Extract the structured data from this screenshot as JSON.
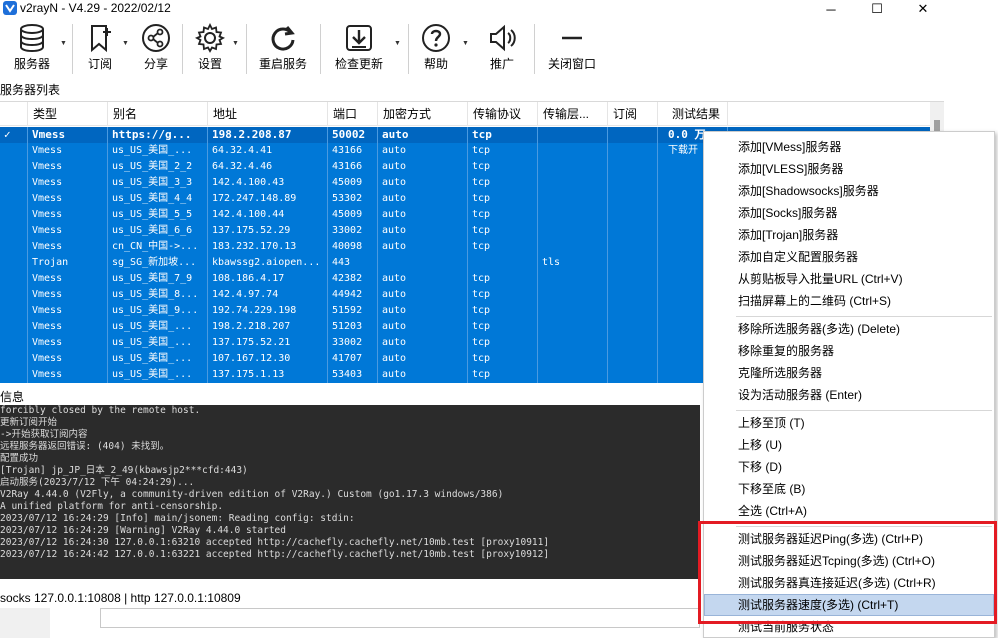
{
  "window": {
    "title": "v2rayN - V4.29 - 2022/02/12",
    "min_glyph": "─",
    "max_glyph": "☐",
    "close_glyph": "✕"
  },
  "toolbar": {
    "servers": "服务器",
    "subscribe": "订阅",
    "share": "分享",
    "settings": "设置",
    "restart": "重启服务",
    "check_update": "检查更新",
    "help": "帮助",
    "promote": "推广",
    "close_window": "关闭窗口",
    "caret": "▼"
  },
  "server_list_label": "服务器列表",
  "grid": {
    "headers": [
      "类型",
      "别名",
      "地址",
      "端口",
      "加密方式",
      "传输协议",
      "传输层...",
      "订阅",
      "测试结果"
    ],
    "rows": [
      [
        "Vmess",
        "https://g...",
        "198.2.208.87",
        "50002",
        "auto",
        "tcp",
        "",
        "",
        "0.0 万"
      ],
      [
        "Vmess",
        "us_US_美国_...",
        "64.32.4.41",
        "43166",
        "auto",
        "tcp",
        "",
        "",
        "下载开"
      ],
      [
        "Vmess",
        "us_US_美国_2_2",
        "64.32.4.46",
        "43166",
        "auto",
        "tcp",
        "",
        "",
        ""
      ],
      [
        "Vmess",
        "us_US_美国_3_3",
        "142.4.100.43",
        "45009",
        "auto",
        "tcp",
        "",
        "",
        ""
      ],
      [
        "Vmess",
        "us_US_美国_4_4",
        "172.247.148.89",
        "53302",
        "auto",
        "tcp",
        "",
        "",
        ""
      ],
      [
        "Vmess",
        "us_US_美国_5_5",
        "142.4.100.44",
        "45009",
        "auto",
        "tcp",
        "",
        "",
        ""
      ],
      [
        "Vmess",
        "us_US_美国_6_6",
        "137.175.52.29",
        "33002",
        "auto",
        "tcp",
        "",
        "",
        ""
      ],
      [
        "Vmess",
        "cn_CN_中国->...",
        "183.232.170.13",
        "40098",
        "auto",
        "tcp",
        "",
        "",
        ""
      ],
      [
        "Trojan",
        "sg_SG_新加坡...",
        "kbawssg2.aiopen...",
        "443",
        "",
        "",
        "tls",
        "",
        ""
      ],
      [
        "Vmess",
        "us_US_美国_7_9",
        "108.186.4.17",
        "42382",
        "auto",
        "tcp",
        "",
        "",
        ""
      ],
      [
        "Vmess",
        "us_US_美国_8...",
        "142.4.97.74",
        "44942",
        "auto",
        "tcp",
        "",
        "",
        ""
      ],
      [
        "Vmess",
        "us_US_美国_9...",
        "192.74.229.198",
        "51592",
        "auto",
        "tcp",
        "",
        "",
        ""
      ],
      [
        "Vmess",
        "us_US_美国_...",
        "198.2.218.207",
        "51203",
        "auto",
        "tcp",
        "",
        "",
        ""
      ],
      [
        "Vmess",
        "us_US_美国_...",
        "137.175.52.21",
        "33002",
        "auto",
        "tcp",
        "",
        "",
        ""
      ],
      [
        "Vmess",
        "us_US_美国_...",
        "107.167.12.30",
        "41707",
        "auto",
        "tcp",
        "",
        "",
        ""
      ],
      [
        "Vmess",
        "us_US_美国_...",
        "137.175.1.13",
        "53403",
        "auto",
        "tcp",
        "",
        "",
        ""
      ]
    ],
    "check_glyph": "✓"
  },
  "info_label": "信息",
  "log": [
    "forcibly closed by the remote host.",
    "更新订阅开始",
    "->开始获取订阅内容",
    "远程服务器返回错误: (404) 未找到。",
    "配置成功",
    "[Trojan] jp_JP_日本_2_49(kbawsjp2***cfd:443)",
    "启动服务(2023/7/12 下午 04:24:29)...",
    "V2Ray 4.44.0 (V2Fly, a community-driven edition of V2Ray.) Custom (go1.17.3 windows/386)",
    "A unified platform for anti-censorship.",
    "2023/07/12 16:24:29 [Info] main/jsonem: Reading config: stdin:",
    "2023/07/12 16:24:29 [Warning] V2Ray 4.44.0 started",
    "2023/07/12 16:24:30 127.0.0.1:63210 accepted http://cachefly.cachefly.net/10mb.test [proxy10911]",
    "2023/07/12 16:24:42 127.0.0.1:63221 accepted http://cachefly.cachefly.net/10mb.test [proxy10912]"
  ],
  "statusbar": "socks 127.0.0.1:10808 | http 127.0.0.1:10809",
  "context_menu": {
    "add_vmess": "添加[VMess]服务器",
    "add_vless": "添加[VLESS]服务器",
    "add_ss": "添加[Shadowsocks]服务器",
    "add_socks": "添加[Socks]服务器",
    "add_trojan": "添加[Trojan]服务器",
    "add_custom": "添加自定义配置服务器",
    "import_clipboard": "从剪贴板导入批量URL (Ctrl+V)",
    "scan_qr": "扫描屏幕上的二维码 (Ctrl+S)",
    "remove_selected": "移除所选服务器(多选) (Delete)",
    "remove_duplicate": "移除重复的服务器",
    "clone_selected": "克隆所选服务器",
    "set_active": "设为活动服务器 (Enter)",
    "move_top": "上移至顶 (T)",
    "move_up": "上移 (U)",
    "move_down": "下移 (D)",
    "move_bottom": "下移至底 (B)",
    "select_all": "全选 (Ctrl+A)",
    "test_ping": "测试服务器延迟Ping(多选) (Ctrl+P)",
    "test_tcping": "测试服务器延迟Tcping(多选) (Ctrl+O)",
    "test_real_delay": "测试服务器真连接延迟(多选) (Ctrl+R)",
    "test_speed": "测试服务器速度(多选) (Ctrl+T)",
    "test_current": "测试当前服务状态"
  },
  "colors": {
    "selection": "#0078d7",
    "highlight": "#c4d7ef",
    "annotation": "#e31b23",
    "log_bg": "#2b2b2b"
  }
}
